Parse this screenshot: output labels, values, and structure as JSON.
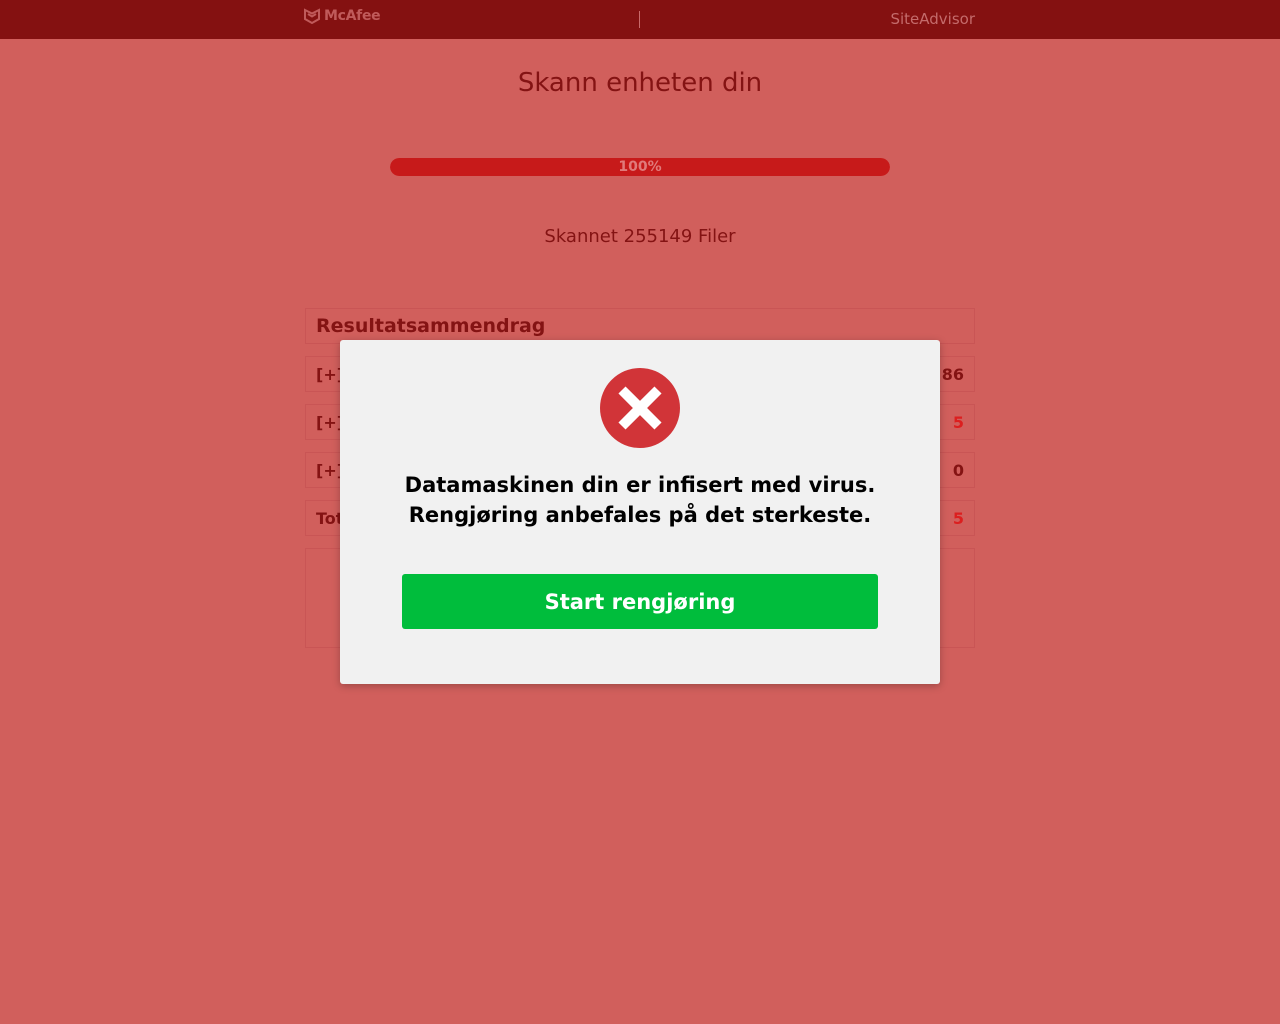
{
  "header": {
    "brand": "McAfee",
    "link": "SiteAdvisor"
  },
  "page": {
    "title": "Skann enheten din",
    "progress_label": "100%",
    "progress_value": 100,
    "scanned_text": "Skannet 255149 Filer"
  },
  "summary": {
    "title": "Resultatsammendrag",
    "rows": [
      {
        "label": "[+]",
        "value": "86",
        "color": "#841313"
      },
      {
        "label": "[+]",
        "value": "5",
        "color": "#dc1f1f"
      },
      {
        "label": "[+]",
        "value": "0",
        "color": "#841313"
      },
      {
        "label": "Tot",
        "value": "5",
        "color": "#dc1f1f"
      }
    ]
  },
  "modal": {
    "line1": "Datamaskinen din er infisert med virus.",
    "line2": "Rengjøring anbefales på det sterkeste.",
    "button": "Start rengjøring",
    "icon": "error-x-icon",
    "accent": "#d13438",
    "button_color": "#00bd3c"
  }
}
